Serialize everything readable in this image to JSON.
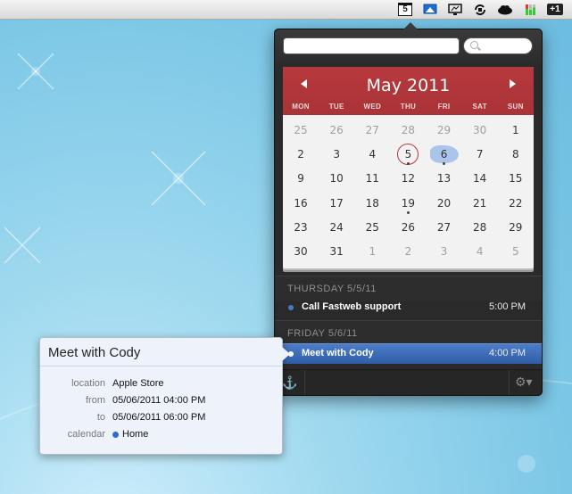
{
  "menubar": {
    "calendar_day": "5",
    "badge": "+1",
    "icons": [
      "calendar-icon",
      "airplay-icon",
      "display-icon",
      "sync-icon",
      "cloud-icon",
      "activity-bars-icon",
      "badge-icon"
    ]
  },
  "panel": {
    "quick_add_placeholder": "",
    "search_placeholder": ""
  },
  "calendar": {
    "month_title": "May 2011",
    "weekdays": [
      "MON",
      "TUE",
      "WED",
      "THU",
      "FRI",
      "SAT",
      "SUN"
    ],
    "weeks": [
      [
        "25",
        "26",
        "27",
        "28",
        "29",
        "30",
        "1"
      ],
      [
        "2",
        "3",
        "4",
        "5",
        "6",
        "7",
        "8"
      ],
      [
        "9",
        "10",
        "11",
        "12",
        "13",
        "14",
        "15"
      ],
      [
        "16",
        "17",
        "18",
        "19",
        "20",
        "21",
        "22"
      ],
      [
        "23",
        "24",
        "25",
        "26",
        "27",
        "28",
        "29"
      ],
      [
        "30",
        "31",
        "1",
        "2",
        "3",
        "4",
        "5"
      ]
    ],
    "today": "5",
    "selected": "6",
    "event_dots": [
      "5",
      "6",
      "19"
    ]
  },
  "events": {
    "sections": [
      {
        "label": "THURSDAY 5/5/11",
        "items": [
          {
            "title": "Call Fastweb support",
            "time": "5:00 PM",
            "color": "#4c79c6"
          }
        ]
      },
      {
        "label": "FRIDAY 5/6/11",
        "items": [
          {
            "title": "Meet with Cody",
            "time": "4:00 PM",
            "color": "#4c79c6"
          }
        ]
      }
    ]
  },
  "detail": {
    "title": "Meet with Cody",
    "location_label": "location",
    "location": "Apple Store",
    "from_label": "from",
    "from": "05/06/2011 04:00 PM",
    "to_label": "to",
    "to": "05/06/2011 06:00 PM",
    "calendar_label": "calendar",
    "calendar": "Home",
    "calendar_color": "#2f6cd6"
  },
  "colors": {
    "calendar_header": "#a93337",
    "selection": "#3b6bb8",
    "panel_bg": "#2a2a2a"
  }
}
